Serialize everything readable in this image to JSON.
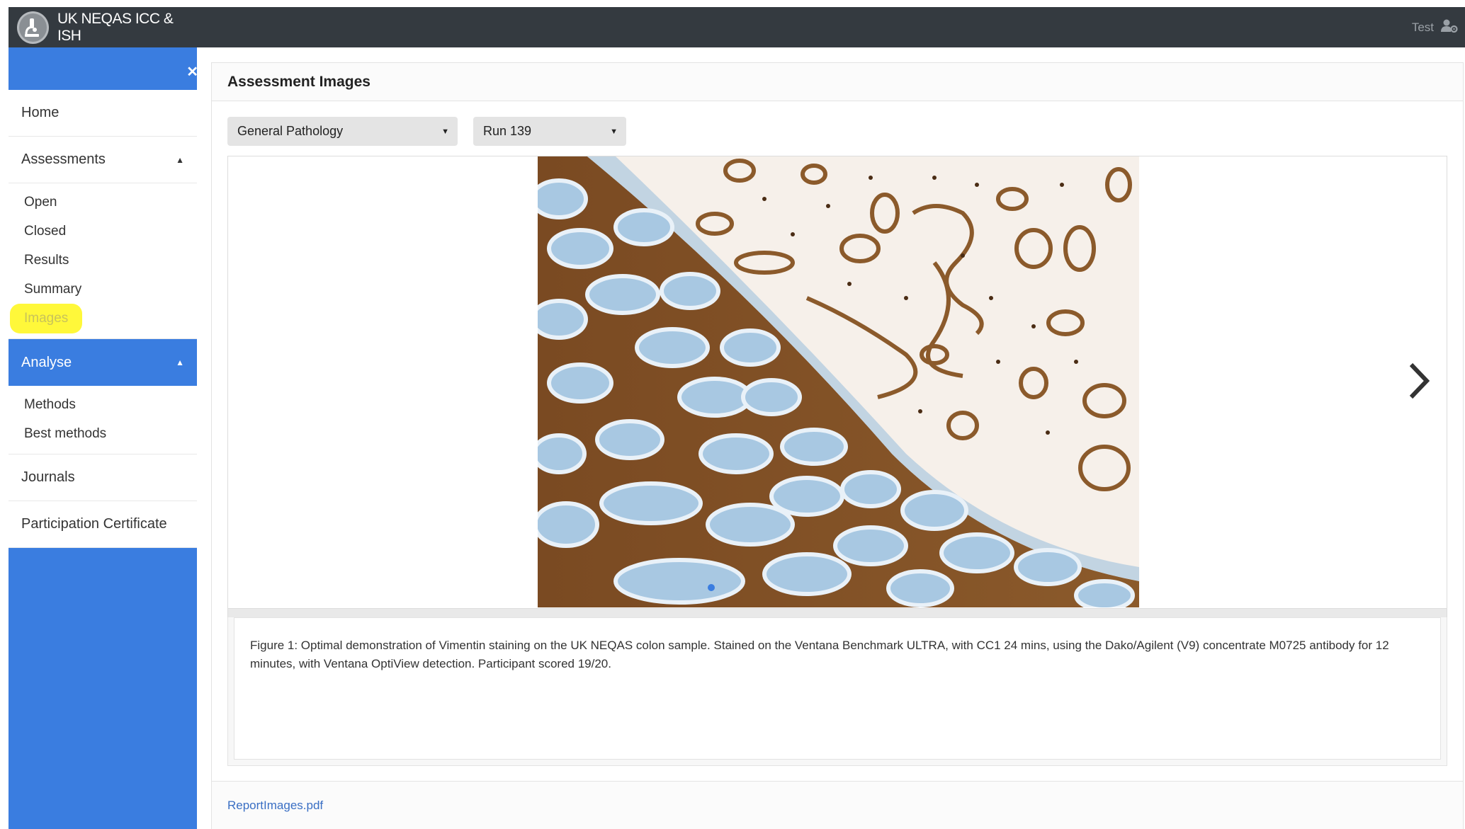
{
  "app": {
    "title": "UK NEQAS ICC & ISH",
    "user": "Test"
  },
  "sidebar": {
    "toggle_icon": "close-icon",
    "home": "Home",
    "assessments": {
      "label": "Assessments",
      "items": [
        "Open",
        "Closed",
        "Results",
        "Summary",
        "Images"
      ],
      "highlighted": "Images"
    },
    "analyse": {
      "label": "Analyse",
      "items": [
        "Methods",
        "Best methods"
      ]
    },
    "journals": "Journals",
    "certificate": "Participation Certificate"
  },
  "page": {
    "title": "Assessment Images",
    "module_select": {
      "value": "General Pathology"
    },
    "run_select": {
      "value": "Run 139"
    },
    "caption": "Figure 1: Optimal demonstration of Vimentin staining on the UK NEQAS colon sample. Stained on the Ventana Benchmark ULTRA, with CC1 24 mins, using the Dako/Agilent (V9) concentrate M0725 antibody for 12 minutes, with Ventana OptiView detection. Participant scored 19/20.",
    "footer_link": "ReportImages.pdf"
  },
  "colors": {
    "topbar": "#343a40",
    "sidebar_accent": "#3a7de0",
    "highlight": "#fff83a",
    "link": "#3a6fc4"
  }
}
